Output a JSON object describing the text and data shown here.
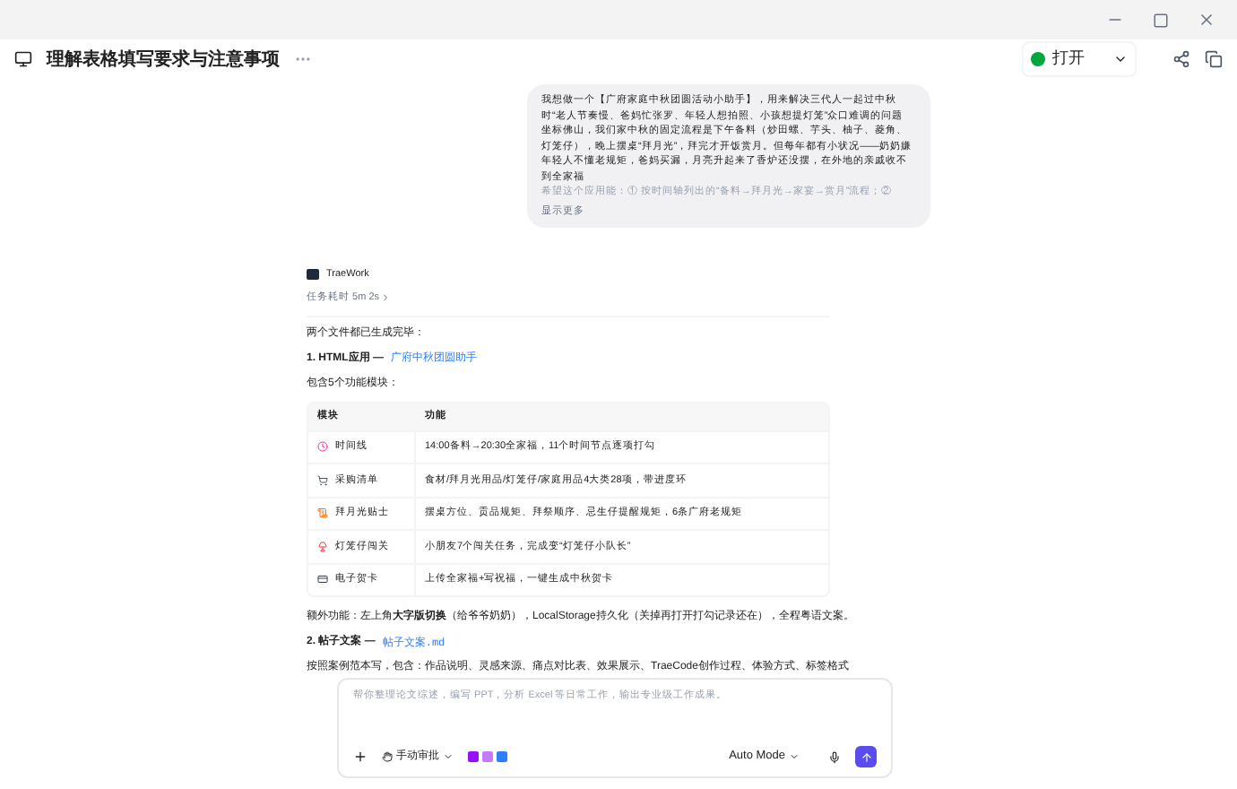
{
  "window": {
    "title": "理解表格填写要求与注意事项",
    "open_button": "打开"
  },
  "user_message": {
    "lines": [
      "我想做一个【广府家庭中秋团圆活动小助手】，用来解决三代人一起过中秋时“老人节奏慢、爸妈忙张罗、年轻人想拍照、小孩想提灯笼”众口难调的问题",
      "坐标佛山，我们家中秋的固定流程是下午备料（炒田螺、芋头、柚子、菱角、灯笼仔），晚上摆桌“拜月光”，拜完才开饭赏月。但每年都有小状况——奶奶嫌年轻人不懂老规矩，爸妈买漏，月亮升起来了香炉还没摆，在外地的亲戚收不到全家福"
    ],
    "faded_line": "希望这个应用能：① 按时间轴列出的“备料→拜月光→家宴→赏月”流程；②",
    "show_more": "显示更多"
  },
  "reply": {
    "agent": "TraeWork",
    "duration": "任务耗时 5m 2s",
    "intro": "两个文件都已生成完毕：",
    "file1_label": "1. HTML应用 —",
    "file1_link": "广府中秋团圆助手",
    "modules_intro": "包含5个功能模块：",
    "table": {
      "columns": [
        "模块",
        "功能"
      ],
      "rows": [
        {
          "module": "时间线",
          "feature": "14:00备料→20:30全家福，11个时间节点逐项打勾"
        },
        {
          "module": "采购清单",
          "feature": "食材/拜月光用品/灯笼仔/家庭用品4大类28项，带进度环"
        },
        {
          "module": "拜月光贴士",
          "feature": "摆桌方位、贡品规矩、拜祭顺序、忌生仔提醒规矩，6条广府老规矩"
        },
        {
          "module": "灯笼仔闯关",
          "feature": "小朋友7个闯关任务，完成变“灯笼仔小队长”"
        },
        {
          "module": "电子贺卡",
          "feature": "上传全家福+写祝福，一键生成中秋贺卡"
        }
      ]
    },
    "extra": "额外功能：左上角**大字版切换**（给爷爷奶奶），LocalStorage持久化（关掉再打开打勾记录还在），全程粤语文案。",
    "file2_label": "2. 帖子文案 —",
    "file2_link": "帖子文案.md",
    "post_desc": "按照案例范本写，包含：作品说明、灵感来源、痛点对比表、效果展示、TraeCode创作过程、体验方式、标签格式"
  },
  "composer": {
    "placeholder": "帮你整理论文综述，编写 PPT，分析 Excel 等日常工作，输出专业级工作成果。",
    "approval": "手动审批",
    "mode": "Auto Mode"
  }
}
